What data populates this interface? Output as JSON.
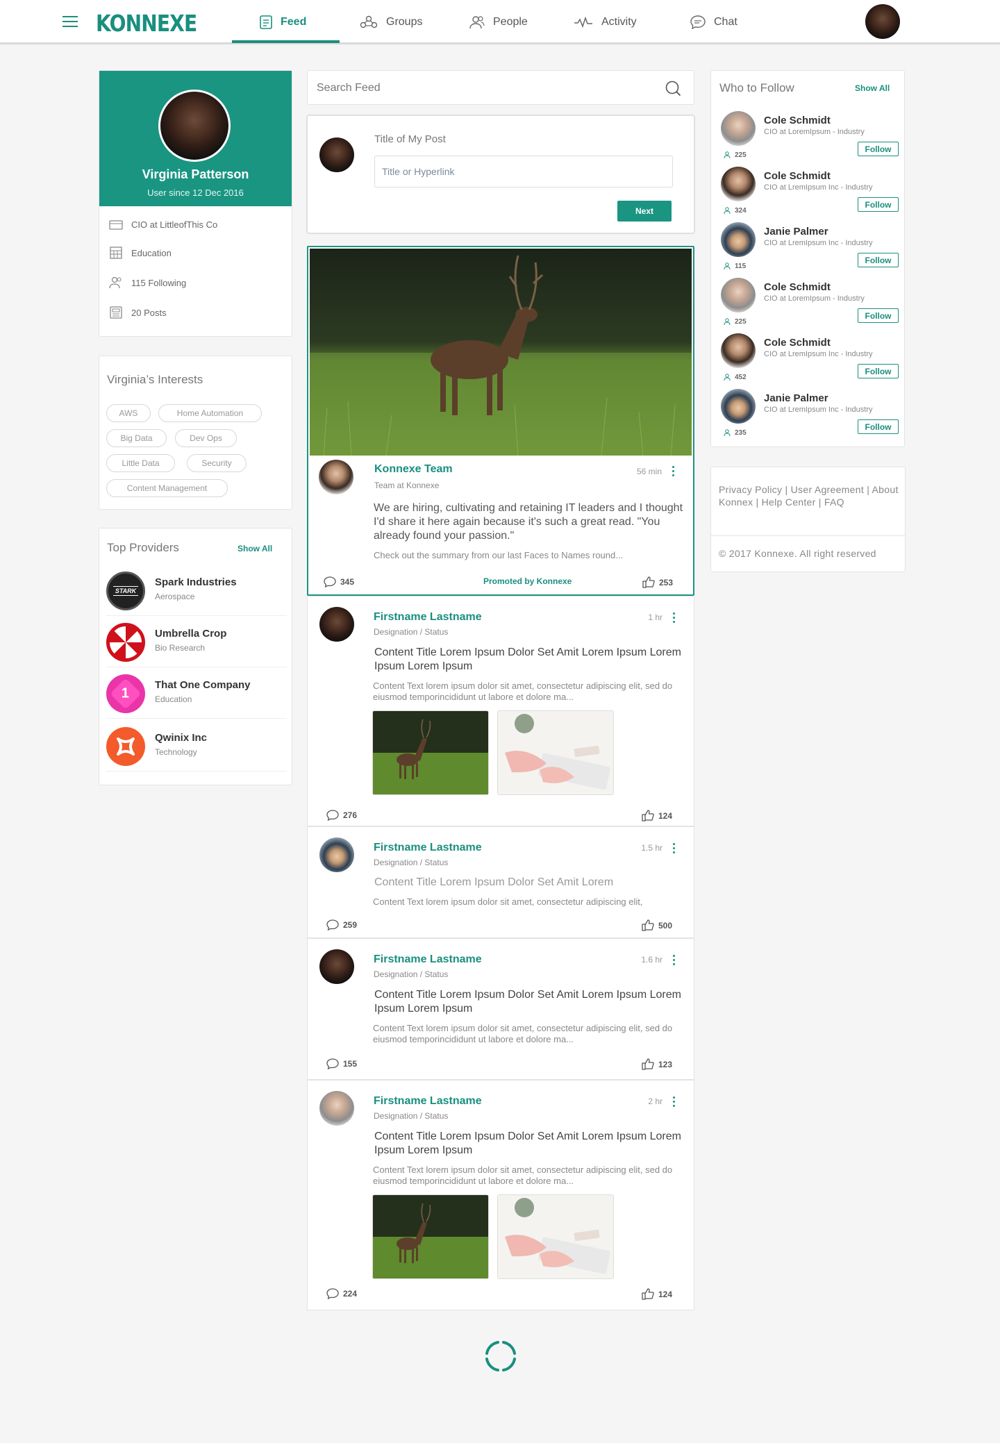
{
  "app": {
    "logo": "KONNEXE",
    "brand_color": "#1a8f7e"
  },
  "nav": {
    "items": [
      {
        "label": "Feed",
        "icon": "feed-icon",
        "active": true
      },
      {
        "label": "Groups",
        "icon": "groups-icon"
      },
      {
        "label": "People",
        "icon": "people-icon"
      },
      {
        "label": "Activity",
        "icon": "activity-icon"
      },
      {
        "label": "Chat",
        "icon": "chat-icon"
      }
    ]
  },
  "profile": {
    "name": "Virginia Patterson",
    "since": "User since 12 Dec 2016",
    "job": "CIO at LittleofThis Co",
    "education": "Education",
    "following": "115 Following",
    "posts": "20 Posts"
  },
  "interests": {
    "title": "Virginia’s Interests",
    "tags": [
      "AWS",
      "Home Automation",
      "Big Data",
      "Dev Ops",
      "Little Data",
      "Security",
      "Content Management"
    ]
  },
  "providers": {
    "title": "Top Providers",
    "show_all": "Show All",
    "items": [
      {
        "name": "Spark Industries",
        "category": "Aerospace",
        "logo_text": "STARK"
      },
      {
        "name": "Umbrella Crop",
        "category": "Bio Research"
      },
      {
        "name": "That One Company",
        "category": "Education",
        "logo_text": "1"
      },
      {
        "name": "Qwinix Inc",
        "category": "Technology"
      }
    ]
  },
  "search": {
    "placeholder": "Search Feed"
  },
  "composer": {
    "label": "Title of My Post",
    "placeholder": "Title or Hyperlink",
    "button": "Next"
  },
  "promoted": {
    "author": "Konnexe Team",
    "subtitle": "Team at Konnexe",
    "time": "56 min",
    "text": "We are hiring, cultivating and retaining IT leaders and I thought I'd share it here again because it's such a great read. \"You already found your passion.\"",
    "summary": "Check out the summary from our last Faces to Names round...",
    "comments": "345",
    "promo_label": "Promoted by Konnexe",
    "likes": "253"
  },
  "posts": [
    {
      "name": "Firstname Lastname",
      "status": "Designation / Status",
      "time": "1 hr",
      "title": "Content Title Lorem Ipsum Dolor Set Amit Lorem Ipsum Lorem Ipsum Lorem Ipsum",
      "text": "Content Text lorem ipsum dolor sit amet, consectetur adipiscing elit, sed do eiusmod temporincididunt ut labore et dolore ma...",
      "comments": "276",
      "likes": "124"
    },
    {
      "name": "Firstname Lastname",
      "status": "Designation / Status",
      "time": "1.5 hr",
      "title": "Content Title Lorem Ipsum Dolor Set Amit Lorem",
      "text": "Content Text lorem ipsum dolor sit amet, consectetur adipiscing elit,",
      "comments": "259",
      "likes": "500"
    },
    {
      "name": "Firstname Lastname",
      "status": "Designation / Status",
      "time": "1.6 hr",
      "title": "Content Title Lorem Ipsum Dolor Set Amit Lorem Ipsum Lorem Ipsum Lorem Ipsum",
      "text": "Content Text lorem ipsum dolor sit amet, consectetur adipiscing elit, sed do eiusmod temporincididunt ut labore et dolore ma...",
      "comments": "155",
      "likes": "123"
    },
    {
      "name": "Firstname Lastname",
      "status": "Designation / Status",
      "time": "2 hr",
      "title": "Content Title Lorem Ipsum Dolor Set Amit Lorem Ipsum Lorem Ipsum Lorem Ipsum",
      "text": "Content Text lorem ipsum dolor sit amet, consectetur adipiscing elit, sed do eiusmod temporincididunt ut labore et dolore ma...",
      "comments": "224",
      "likes": "124"
    }
  ],
  "who_to_follow": {
    "title": "Who to Follow",
    "show_all": "Show All",
    "button": "Follow",
    "items": [
      {
        "name": "Cole Schmidt",
        "title": "CIO at LoremIpsum - Industry",
        "count": "225"
      },
      {
        "name": "Cole Schmidt",
        "title": "CIO at LremIpsum Inc - Industry",
        "count": "324"
      },
      {
        "name": "Janie Palmer",
        "title": "CIO at LremIpsum Inc - Industry",
        "count": "115"
      },
      {
        "name": "Cole Schmidt",
        "title": "CIO at LoremIpsum - Industry",
        "count": "225"
      },
      {
        "name": "Cole Schmidt",
        "title": "CIO at LremIpsum Inc - Industry",
        "count": "452"
      },
      {
        "name": "Janie Palmer",
        "title": "CIO at LremIpsum Inc - Industry",
        "count": "235"
      }
    ]
  },
  "footer": {
    "links": "Privacy Policy  |  User Agreement  |  About Konnex | Help Center | FAQ",
    "copyright": "© 2017 Konnexe. All right reserved"
  }
}
